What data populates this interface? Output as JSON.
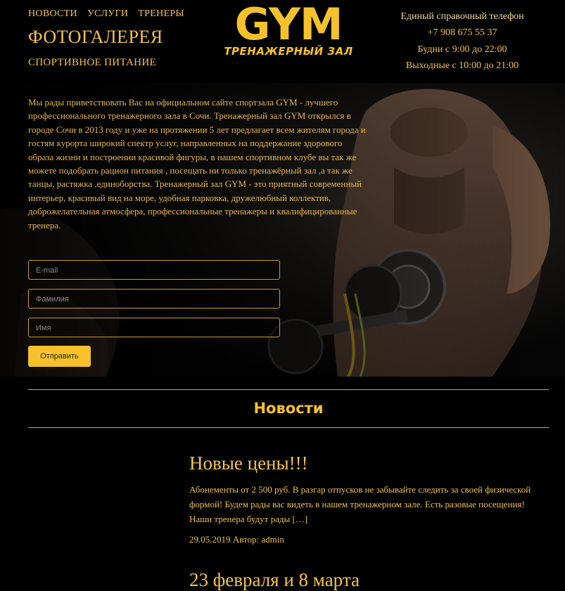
{
  "nav": {
    "items": [
      "НОВОСТИ",
      "УСЛУГИ",
      "ТРЕНЕРЫ"
    ],
    "photo_gallery": "ФОТОГАЛЕРЕЯ",
    "nutrition": "СПОРТИВНОЕ ПИТАНИЕ"
  },
  "logo": {
    "title": "GYM",
    "subtitle": "ТРЕНАЖЕРНЫЙ ЗАЛ"
  },
  "contacts": {
    "title": "Единый справочный телефон",
    "phone": "+7 908 675 55 37",
    "weekdays": "Будни с 9:00 до 22:00",
    "weekends": "Выходные с 10:00 до 21:00"
  },
  "hero": {
    "text": "Мы рады приветствовать Вас на официальном сайте спортзала GYM - лучшего профессионального тренажерного зала в Сочи. Тренажерный зал GYM открылся в городе Сочи в 2013 году и уже на протяжении 5 лет предлагает всем жителям города и гостям курорта широкий спектр услуг, направленных на поддержание здорового образа жизни и построении красивой фигуры, в нашем спортивном клубе вы так же можете подобрать рацион питания , посещать ни только тренажёрный зал ,а так же танцы, растяжка ,единоборства. Тренажерный зал GYM - это приятный современный интерьер, красивый вид на море, удобная парковка, дружелюбный коллектив, доброжелательная атмосфера, профессиональные тренажеры и квалифицированные тренера."
  },
  "form": {
    "email_placeholder": "E-mail",
    "surname_placeholder": "Фамилия",
    "name_placeholder": "Имя",
    "submit_label": "Отправить"
  },
  "news": {
    "heading": "Новости",
    "posts": [
      {
        "title": "Новые цены!!!",
        "excerpt": "Абонементы от 2 500 руб. В разгар отпусков не забывайте следить за своей физической формой! Будем рады вас видеть в нашем тренажерном зале. Есть разовые посещения! Наши тренера будут рады […]",
        "meta": "29.05.2019 Автор: admin"
      },
      {
        "title": "23 февраля и 8 марта"
      }
    ]
  },
  "colors": {
    "accent": "#f5c22b",
    "background": "#000000"
  }
}
